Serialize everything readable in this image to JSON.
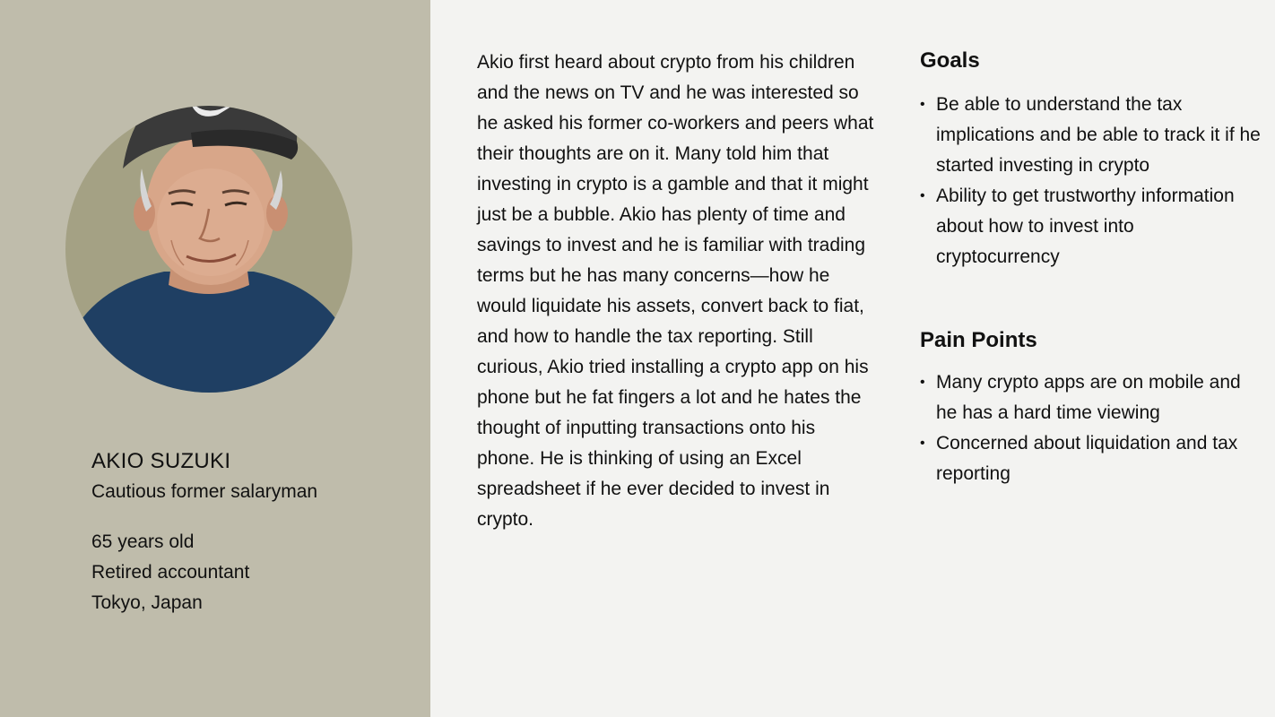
{
  "persona": {
    "photo_icon": "person-portrait",
    "name": "AKIO SUZUKI",
    "tagline": "Cautious former salaryman",
    "details": [
      "65 years old",
      "Retired accountant",
      "Tokyo, Japan"
    ]
  },
  "story": "Akio first heard about crypto from his children and the news on TV and he was interested so he asked his former co-workers and peers what their thoughts are on it. Many told him that investing in crypto is a gamble and that it might just be a bubble. Akio has plenty of time and savings to invest and he is familiar with trading terms but he has many concerns—how he would liquidate his assets, convert back to fiat, and how to handle the tax reporting. Still curious, Akio tried installing a crypto app on his phone but he fat fingers a lot and he hates the thought of inputting transactions onto his phone. He is thinking of using an Excel spreadsheet if he ever decided to invest in crypto.",
  "goals": {
    "title": "Goals",
    "items": [
      "Be able to understand the tax implications and be able to track it if he started investing in crypto",
      "Ability to get trustworthy information about how to invest into cryptocurrency"
    ]
  },
  "pain_points": {
    "title": "Pain Points",
    "items": [
      "Many crypto apps are on mobile and he has a hard time viewing",
      "Concerned about liquidation and tax reporting"
    ]
  },
  "colors": {
    "left_panel": "#bfbcab",
    "page_background": "#f3f3f1",
    "photo_circle": "#a4a184",
    "text": "#111111"
  }
}
